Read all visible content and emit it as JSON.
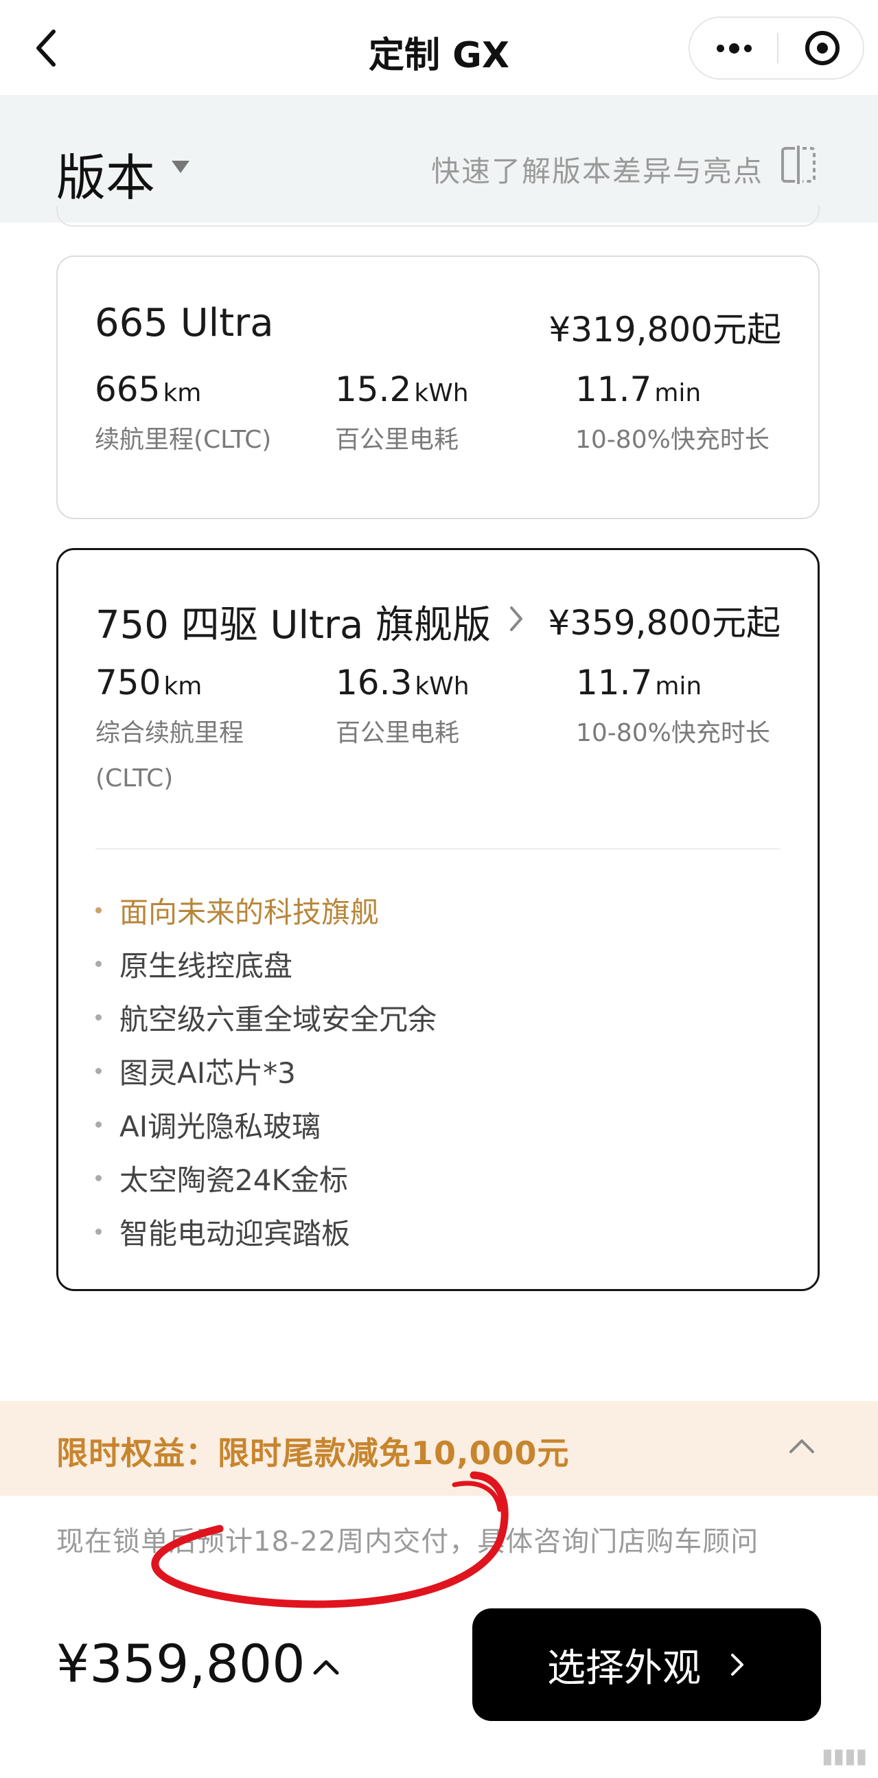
{
  "nav": {
    "title": "定制 GX"
  },
  "section": {
    "title": "版本",
    "compare_link": "快速了解版本差异与亮点"
  },
  "versions": [
    {
      "name": "665 Ultra",
      "price": "¥319,800元起",
      "specs": [
        {
          "value": "665",
          "unit": "km",
          "label": "续航里程(CLTC)"
        },
        {
          "value": "15.2",
          "unit": "kWh",
          "label": "百公里电耗"
        },
        {
          "value": "11.7",
          "unit": "min",
          "label": "10-80%快充时长"
        }
      ]
    },
    {
      "name": "750 四驱 Ultra 旗舰版",
      "price": "¥359,800元起",
      "specs": [
        {
          "value": "750",
          "unit": "km",
          "label_line1": "综合续航里程",
          "label_line2": "(CLTC)"
        },
        {
          "value": "16.3",
          "unit": "kWh",
          "label": "百公里电耗"
        },
        {
          "value": "11.7",
          "unit": "min",
          "label": "10-80%快充时长"
        }
      ],
      "features": [
        "面向未来的科技旗舰",
        "原生线控底盘",
        "航空级六重全域安全冗余",
        "图灵AI芯片*3",
        "AI调光隐私玻璃",
        "太空陶瓷24K金标",
        "智能电动迎宾踏板"
      ]
    }
  ],
  "promo": {
    "text": "限时权益：限时尾款减免10,000元"
  },
  "delivery_note": "现在锁单后预计18-22周内交付，具体咨询门店购车顾问",
  "bottom": {
    "total": "¥359,800",
    "cta_label": "选择外观"
  },
  "colors": {
    "promo_text": "#c7852d",
    "promo_bg": "#fbeee3",
    "highlight_feature": "#b8863a",
    "annotation": "#e0141e"
  },
  "icons": [
    "back-chevron-icon",
    "more-dots-icon",
    "mini-program-close-icon",
    "dropdown-caret-icon",
    "compare-icon",
    "chevron-right-icon",
    "chevron-up-icon"
  ]
}
